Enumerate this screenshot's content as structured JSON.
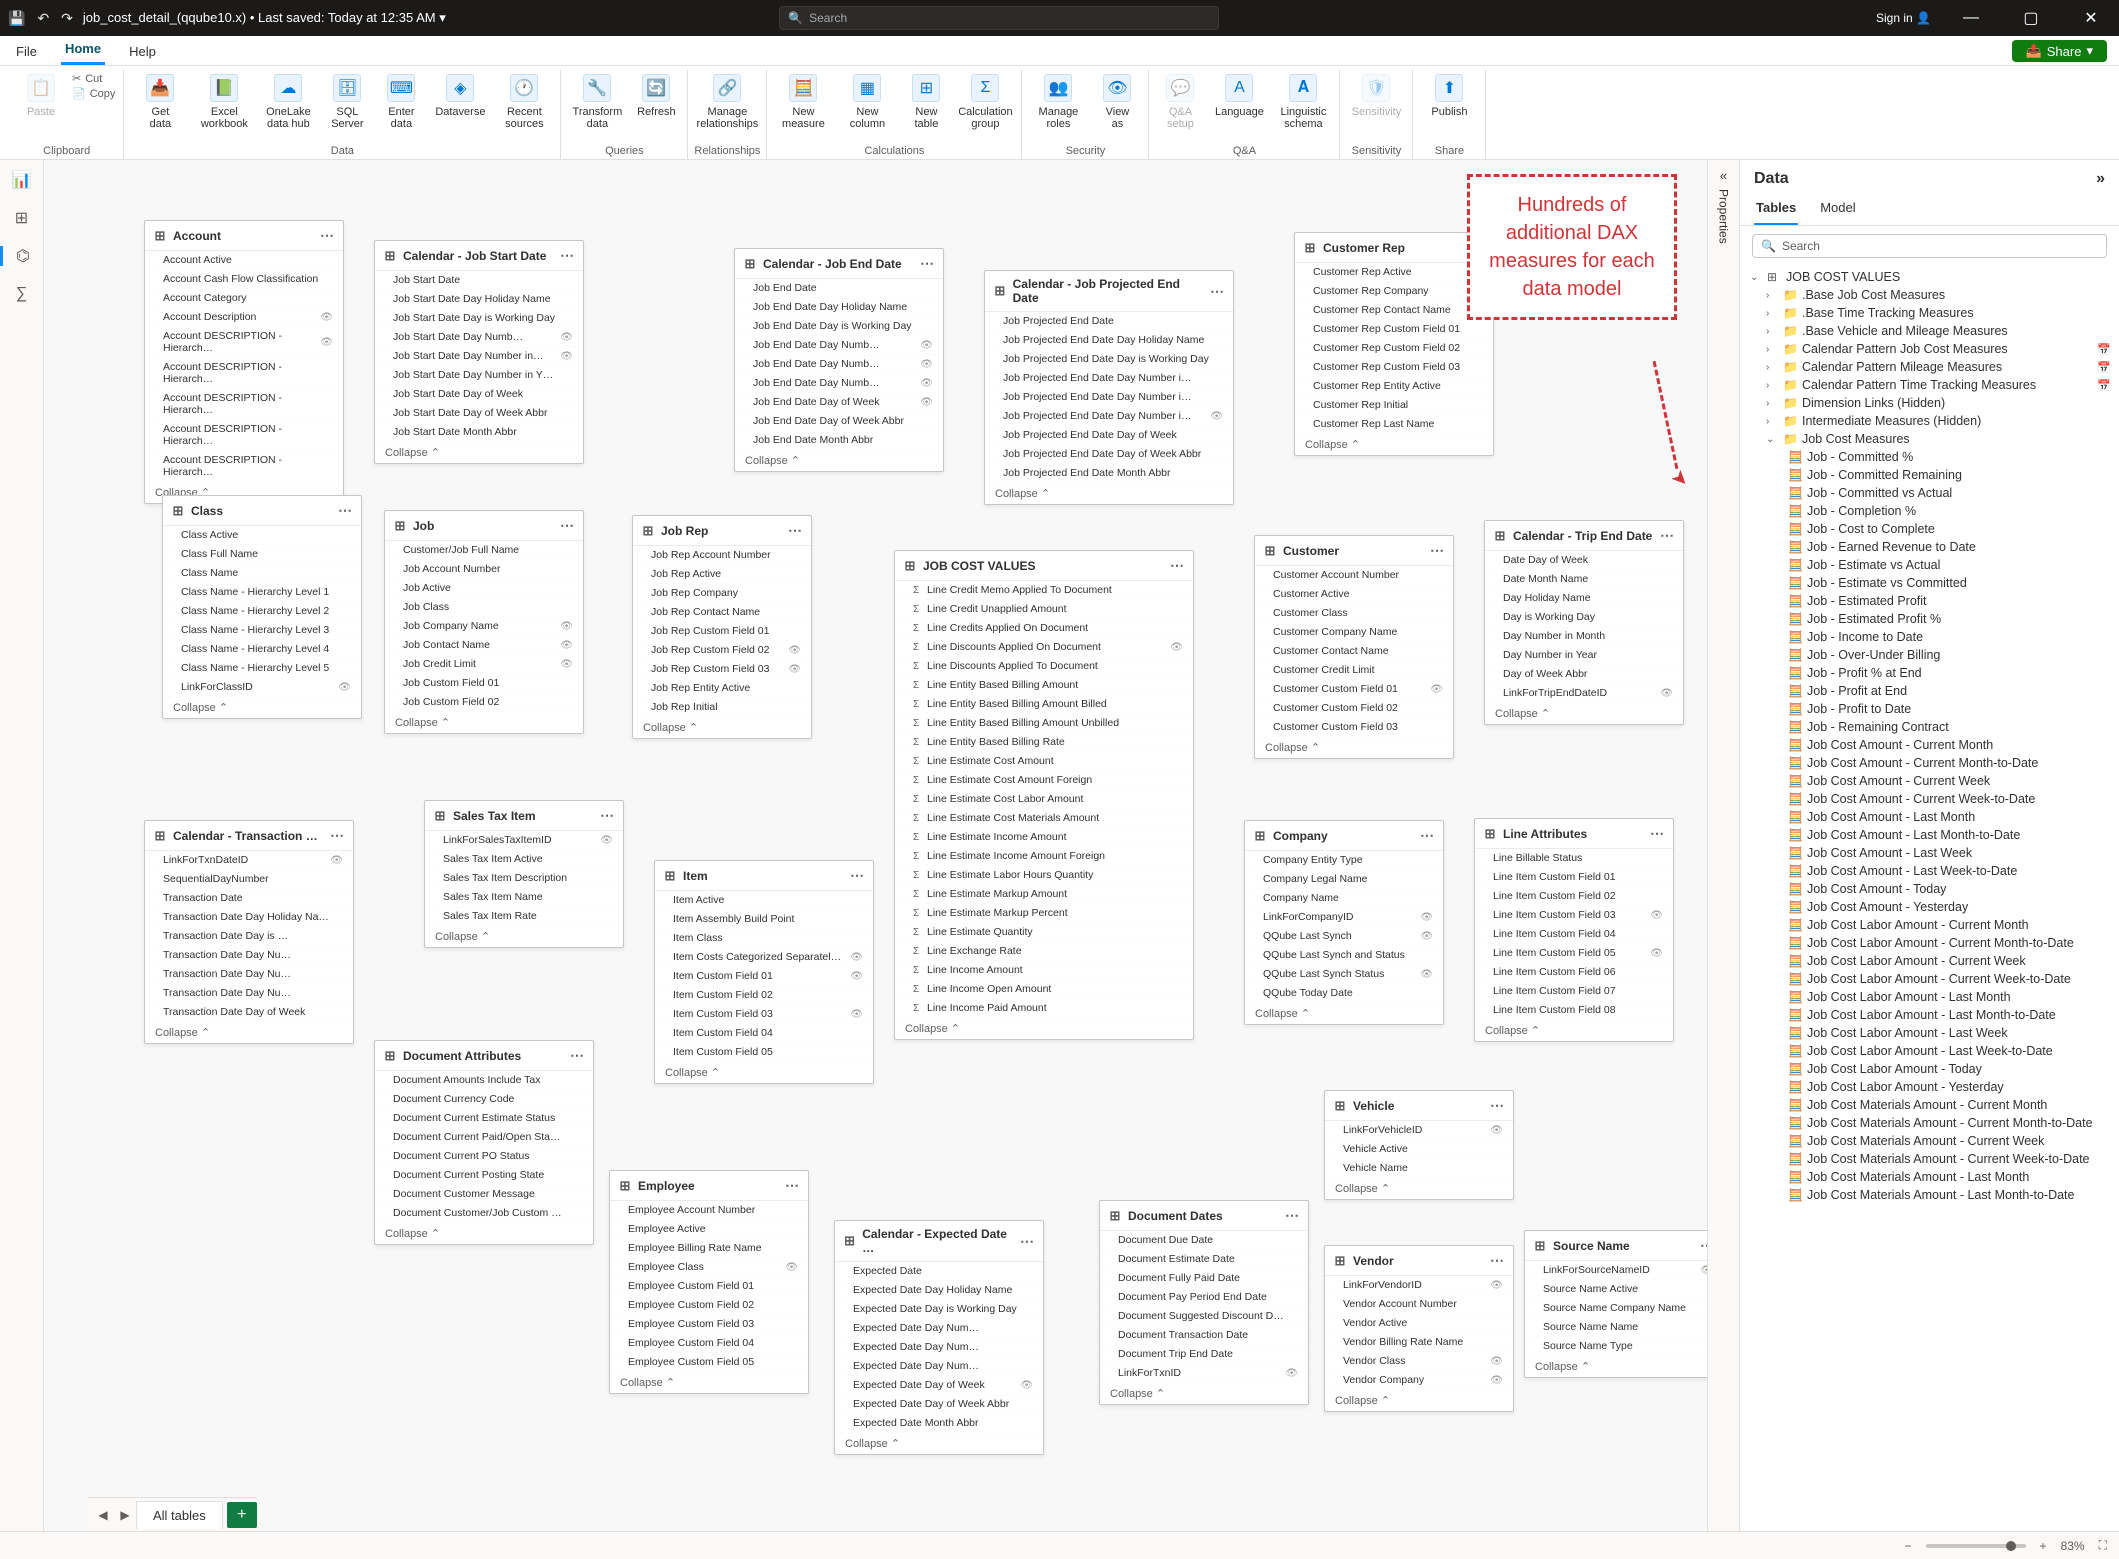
{
  "titlebar": {
    "filename": "job_cost_detail_(qqube10.x)",
    "saved": "Last saved: Today at 12:35 AM",
    "search_placeholder": "Search",
    "signin": "Sign in"
  },
  "menutabs": {
    "file": "File",
    "home": "Home",
    "help": "Help",
    "share": "Share"
  },
  "ribbon": {
    "clipboard": {
      "paste": "Paste",
      "cut": "Cut",
      "copy": "Copy",
      "group": "Clipboard"
    },
    "data_group": "Data",
    "queries_group": "Queries",
    "relationships_group": "Relationships",
    "calculations_group": "Calculations",
    "security_group": "Security",
    "qa_group": "Q&A",
    "sensitivity_group": "Sensitivity",
    "share_group": "Share",
    "btns": {
      "getdata": "Get\ndata",
      "excel": "Excel\nworkbook",
      "onelake": "OneLake\ndata hub",
      "sql": "SQL\nServer",
      "enter": "Enter\ndata",
      "dataverse": "Dataverse",
      "recent": "Recent\nsources",
      "transform": "Transform\ndata",
      "refresh": "Refresh",
      "manage_rel": "Manage\nrelationships",
      "new_measure": "New\nmeasure",
      "new_column": "New\ncolumn",
      "new_table": "New\ntable",
      "calc_group": "Calculation\ngroup",
      "manage_roles": "Manage\nroles",
      "view_as": "View\nas",
      "qa_setup": "Q&A\nsetup",
      "language": "Language",
      "ling_schema": "Linguistic\nschema",
      "sensitivity": "Sensitivity",
      "publish": "Publish"
    }
  },
  "annotation": "Hundreds of additional DAX measures for each data model",
  "entities": {
    "account": {
      "title": "Account",
      "fields": [
        "Account Active",
        "Account Cash Flow Classification",
        "Account Category",
        "Account Description",
        "Account DESCRIPTION - Hierarch…",
        "Account DESCRIPTION - Hierarch…",
        "Account DESCRIPTION - Hierarch…",
        "Account DESCRIPTION - Hierarch…",
        "Account DESCRIPTION - Hierarch…"
      ]
    },
    "cal_jobstart": {
      "title": "Calendar - Job Start Date",
      "fields": [
        "Job Start Date",
        "Job Start Date Day Holiday Name",
        "Job Start Date Day is Working Day",
        "Job Start Date Day Numb…",
        "Job Start Date Day Number in…",
        "Job Start Date Day Number in Y…",
        "Job Start Date Day of Week",
        "Job Start Date Day of Week Abbr",
        "Job Start Date Month Abbr"
      ]
    },
    "cal_jobend": {
      "title": "Calendar - Job End Date",
      "fields": [
        "Job End Date",
        "Job End Date Day Holiday Name",
        "Job End Date Day is Working Day",
        "Job End Date Day Numb…",
        "Job End Date Day Numb…",
        "Job End Date Day Numb…",
        "Job End Date Day of Week",
        "Job End Date Day of Week Abbr",
        "Job End Date Month Abbr"
      ]
    },
    "cal_jobproj": {
      "title": "Calendar - Job Projected End Date",
      "fields": [
        "Job Projected End Date",
        "Job Projected End Date Day Holiday Name",
        "Job Projected End Date Day is Working Day",
        "Job Projected End Date Day Number i…",
        "Job Projected End Date Day Number i…",
        "Job Projected End Date Day Number i…",
        "Job Projected End Date Day of Week",
        "Job Projected End Date Day of Week Abbr",
        "Job Projected End Date Month Abbr"
      ]
    },
    "custrep": {
      "title": "Customer Rep",
      "fields": [
        "Customer Rep Active",
        "Customer Rep Company",
        "Customer Rep Contact Name",
        "Customer Rep Custom Field 01",
        "Customer Rep Custom Field 02",
        "Customer Rep Custom Field 03",
        "Customer Rep Entity Active",
        "Customer Rep Initial",
        "Customer Rep Last Name"
      ]
    },
    "class": {
      "title": "Class",
      "fields": [
        "Class Active",
        "Class Full Name",
        "Class Name",
        "Class Name - Hierarchy Level 1",
        "Class Name - Hierarchy Level 2",
        "Class Name - Hierarchy Level 3",
        "Class Name - Hierarchy Level 4",
        "Class Name - Hierarchy Level 5",
        "LinkForClassID"
      ]
    },
    "job": {
      "title": "Job",
      "fields": [
        "Customer/Job Full Name",
        "Job Account Number",
        "Job Active",
        "Job Class",
        "Job Company Name",
        "Job Contact Name",
        "Job Credit Limit",
        "Job Custom Field 01",
        "Job Custom Field 02"
      ]
    },
    "jobrep": {
      "title": "Job Rep",
      "fields": [
        "Job Rep Account Number",
        "Job Rep Active",
        "Job Rep Company",
        "Job Rep Contact Name",
        "Job Rep Custom Field 01",
        "Job Rep Custom Field 02",
        "Job Rep Custom Field 03",
        "Job Rep Entity Active",
        "Job Rep Initial"
      ]
    },
    "jcv": {
      "title": "JOB COST VALUES",
      "fields": [
        "Line Credit Memo Applied To Document",
        "Line Credit Unapplied Amount",
        "Line Credits Applied On Document",
        "Line Discounts Applied On Document",
        "Line Discounts Applied To Document",
        "Line Entity Based Billing Amount",
        "Line Entity Based Billing Amount Billed",
        "Line Entity Based Billing Amount Unbilled",
        "Line Entity Based Billing Rate",
        "Line Estimate Cost Amount",
        "Line Estimate Cost Amount Foreign",
        "Line Estimate Cost Labor Amount",
        "Line Estimate Cost Materials Amount",
        "Line Estimate Income Amount",
        "Line Estimate Income Amount Foreign",
        "Line Estimate Labor Hours Quantity",
        "Line Estimate Markup Amount",
        "Line Estimate Markup Percent",
        "Line Estimate Quantity",
        "Line Exchange Rate",
        "Line Income Amount",
        "Line Income Open Amount",
        "Line Income Paid Amount"
      ]
    },
    "customer": {
      "title": "Customer",
      "fields": [
        "Customer Account Number",
        "Customer Active",
        "Customer Class",
        "Customer Company Name",
        "Customer Contact Name",
        "Customer Credit Limit",
        "Customer Custom Field 01",
        "Customer Custom Field 02",
        "Customer Custom Field 03"
      ]
    },
    "tripend": {
      "title": "Calendar - Trip End Date",
      "fields": [
        "Date Day of Week",
        "Date Month Name",
        "Day Holiday Name",
        "Day is Working Day",
        "Day Number in Month",
        "Day Number in Year",
        "Day of Week Abbr",
        "LinkForTripEndDateID"
      ]
    },
    "salestax": {
      "title": "Sales Tax Item",
      "fields": [
        "LinkForSalesTaxItemID",
        "Sales Tax Item Active",
        "Sales Tax Item Description",
        "Sales Tax Item Name",
        "Sales Tax Item Rate"
      ]
    },
    "caltxn": {
      "title": "Calendar - Transaction …",
      "fields": [
        "LinkForTxnDateID",
        "SequentialDayNumber",
        "Transaction Date",
        "Transaction Date Day Holiday Na…",
        "Transaction Date Day is …",
        "Transaction Date Day Nu…",
        "Transaction Date Day Nu…",
        "Transaction Date Day Nu…",
        "Transaction Date Day of Week"
      ]
    },
    "item": {
      "title": "Item",
      "fields": [
        "Item Active",
        "Item Assembly Build Point",
        "Item Class",
        "Item Costs Categorized Separatel…",
        "Item Custom Field 01",
        "Item Custom Field 02",
        "Item Custom Field 03",
        "Item Custom Field 04",
        "Item Custom Field 05"
      ]
    },
    "company": {
      "title": "Company",
      "fields": [
        "Company Entity Type",
        "Company Legal Name",
        "Company Name",
        "LinkForCompanyID",
        "QQube Last Synch",
        "QQube Last Synch and Status",
        "QQube Last Synch Status",
        "QQube Today Date"
      ]
    },
    "lineattr": {
      "title": "Line Attributes",
      "fields": [
        "Line Billable Status",
        "Line Item Custom Field 01",
        "Line Item Custom Field 02",
        "Line Item Custom Field 03",
        "Line Item Custom Field 04",
        "Line Item Custom Field 05",
        "Line Item Custom Field 06",
        "Line Item Custom Field 07",
        "Line Item Custom Field 08"
      ]
    },
    "docattr": {
      "title": "Document Attributes",
      "fields": [
        "Document Amounts Include Tax",
        "Document Currency Code",
        "Document Current Estimate Status",
        "Document Current Paid/Open Sta…",
        "Document Current PO Status",
        "Document Current Posting State",
        "Document Customer Message",
        "Document Customer/Job Custom …"
      ]
    },
    "vehicle": {
      "title": "Vehicle",
      "fields": [
        "LinkForVehicleID",
        "Vehicle Active",
        "Vehicle Name"
      ]
    },
    "employee": {
      "title": "Employee",
      "fields": [
        "Employee Account Number",
        "Employee Active",
        "Employee Billing Rate Name",
        "Employee Class",
        "Employee Custom Field 01",
        "Employee Custom Field 02",
        "Employee Custom Field 03",
        "Employee Custom Field 04",
        "Employee Custom Field 05"
      ]
    },
    "calexp": {
      "title": "Calendar - Expected Date …",
      "fields": [
        "Expected Date",
        "Expected Date Day Holiday Name",
        "Expected Date Day is Working Day",
        "Expected Date Day Num…",
        "Expected Date Day Num…",
        "Expected Date Day Num…",
        "Expected Date Day of Week",
        "Expected Date Day of Week Abbr",
        "Expected Date Month Abbr"
      ]
    },
    "docdates": {
      "title": "Document Dates",
      "fields": [
        "Document Due Date",
        "Document Estimate Date",
        "Document Fully Paid Date",
        "Document Pay Period End Date",
        "Document Suggested Discount D…",
        "Document Transaction Date",
        "Document Trip End Date",
        "LinkForTxnID"
      ]
    },
    "vendor": {
      "title": "Vendor",
      "fields": [
        "LinkForVendorID",
        "Vendor Account Number",
        "Vendor Active",
        "Vendor Billing Rate Name",
        "Vendor Class",
        "Vendor Company"
      ]
    },
    "sourcename": {
      "title": "Source Name",
      "fields": [
        "LinkForSourceNameID",
        "Source Name Active",
        "Source Name Company Name",
        "Source Name Name",
        "Source Name Type"
      ]
    }
  },
  "datapane": {
    "title": "Data",
    "tab_tables": "Tables",
    "tab_model": "Model",
    "search_ph": "Search",
    "root": "JOB COST VALUES",
    "folders": [
      ".Base Job Cost Measures",
      ".Base Time Tracking Measures",
      ".Base Vehicle and Mileage Measures",
      "Calendar Pattern Job Cost Measures",
      "Calendar Pattern Mileage Measures",
      "Calendar Pattern Time Tracking Measures",
      "Dimension Links (Hidden)",
      "Intermediate Measures (Hidden)"
    ],
    "open_folder": "Job Cost Measures",
    "measures": [
      "Job - Committed %",
      "Job - Committed Remaining",
      "Job - Committed vs Actual",
      "Job - Completion %",
      "Job - Cost to Complete",
      "Job - Earned Revenue to Date",
      "Job - Estimate vs Actual",
      "Job - Estimate vs Committed",
      "Job - Estimated Profit",
      "Job - Estimated Profit %",
      "Job - Income to Date",
      "Job - Over-Under Billing",
      "Job - Profit % at End",
      "Job - Profit at End",
      "Job - Profit to Date",
      "Job - Remaining Contract",
      "Job Cost Amount - Current Month",
      "Job Cost Amount - Current Month-to-Date",
      "Job Cost Amount - Current Week",
      "Job Cost Amount - Current Week-to-Date",
      "Job Cost Amount - Last Month",
      "Job Cost Amount - Last Month-to-Date",
      "Job Cost Amount - Last Week",
      "Job Cost Amount - Last Week-to-Date",
      "Job Cost Amount - Today",
      "Job Cost Amount - Yesterday",
      "Job Cost Labor Amount - Current Month",
      "Job Cost Labor Amount - Current Month-to-Date",
      "Job Cost Labor Amount - Current Week",
      "Job Cost Labor Amount - Current Week-to-Date",
      "Job Cost Labor Amount - Last Month",
      "Job Cost Labor Amount - Last Month-to-Date",
      "Job Cost Labor Amount - Last Week",
      "Job Cost Labor Amount - Last Week-to-Date",
      "Job Cost Labor Amount - Today",
      "Job Cost Labor Amount - Yesterday",
      "Job Cost Materials Amount - Current Month",
      "Job Cost Materials Amount - Current Month-to-Date",
      "Job Cost Materials Amount - Current Week",
      "Job Cost Materials Amount - Current Week-to-Date",
      "Job Cost Materials Amount - Last Month",
      "Job Cost Materials Amount - Last Month-to-Date"
    ]
  },
  "sheet": {
    "all_tables": "All tables"
  },
  "status": {
    "zoom": "83%"
  },
  "collapse_label": "Collapse",
  "properties_label": "Properties"
}
